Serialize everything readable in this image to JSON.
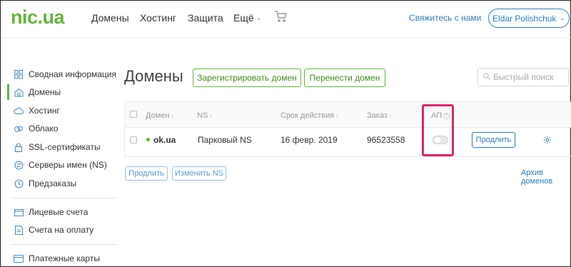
{
  "header": {
    "logo_main": "nic",
    "logo_dot": ".",
    "logo_tld": "ua",
    "nav": [
      {
        "label": "Домены"
      },
      {
        "label": "Хостинг"
      },
      {
        "label": "Защита"
      },
      {
        "label": "Ещё"
      }
    ],
    "contact_label": "Свяжитесь с нами",
    "user_label": "Eldar Polishchuk",
    "accent_color": "#66b53a",
    "link_color": "#2c7dbd"
  },
  "sidebar": {
    "items": [
      {
        "label": "Сводная информация",
        "icon": "dashboard-grid-icon"
      },
      {
        "label": "Домены",
        "icon": "home-icon",
        "active": true
      },
      {
        "label": "Хостинг",
        "icon": "cloud-icon"
      },
      {
        "label": "Облако",
        "icon": "cloud-layers-icon"
      },
      {
        "label": "SSL-сертификаты",
        "icon": "lock-icon"
      },
      {
        "label": "Серверы имен (NS)",
        "icon": "arrows-circle-icon"
      },
      {
        "label": "Предзаказы",
        "icon": "clock-icon"
      },
      {
        "label": "Лицевые счета",
        "icon": "wallet-icon"
      },
      {
        "label": "Счета на оплату",
        "icon": "document-icon"
      },
      {
        "label": "Платежные карты",
        "icon": "card-icon"
      }
    ]
  },
  "main": {
    "title": "Домены",
    "register_label": "Зарегистрировать домен",
    "transfer_label": "Перенести домен",
    "search_placeholder": "Быстрый поиск",
    "columns": [
      "Домен",
      "NS",
      "Срок действия",
      "Заказ",
      "АП"
    ],
    "sort_glyph": "↕",
    "rows": [
      {
        "domain": "ok.ua",
        "ns": "Парковый NS",
        "expires": "16 февр. 2019",
        "order": "96523558",
        "autorenew": false,
        "renew_label": "Продлить"
      }
    ],
    "bulk_renew_label": "Продлить",
    "bulk_change_ns_label": "Изменить NS",
    "archive_label": "Архив доменов",
    "highlight_color": "#e0236c"
  }
}
